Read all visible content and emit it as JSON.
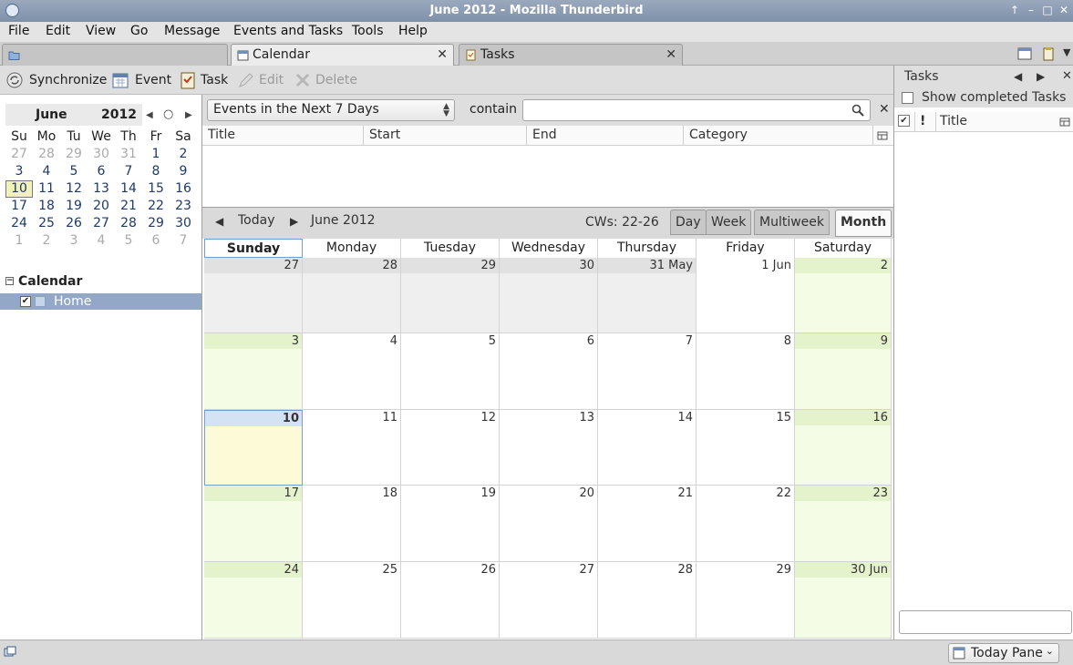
{
  "window": {
    "title": "June 2012 - Mozilla Thunderbird",
    "buttons": [
      "↑",
      "–",
      "□",
      "✕"
    ]
  },
  "menu": [
    "File",
    "Edit",
    "View",
    "Go",
    "Message",
    "Events and Tasks",
    "Tools",
    "Help"
  ],
  "tabs": [
    {
      "label": "",
      "icon": "folder-icon"
    },
    {
      "label": "Calendar",
      "icon": "calendar-icon",
      "active": true
    },
    {
      "label": "Tasks",
      "icon": "tasks-icon"
    }
  ],
  "tab_close": "✕",
  "toolbar": {
    "synchronize": "Synchronize",
    "event": "Event",
    "task": "Task",
    "edit": "Edit",
    "delete": "Delete"
  },
  "minimonth": {
    "month": "June",
    "year": "2012",
    "nav": [
      "◀",
      "○",
      "▶"
    ],
    "weekdays": [
      "Su",
      "Mo",
      "Tu",
      "We",
      "Th",
      "Fr",
      "Sa"
    ],
    "weeks": [
      [
        "27",
        "28",
        "29",
        "30",
        "31",
        "1",
        "2"
      ],
      [
        "3",
        "4",
        "5",
        "6",
        "7",
        "8",
        "9"
      ],
      [
        "10",
        "11",
        "12",
        "13",
        "14",
        "15",
        "16"
      ],
      [
        "17",
        "18",
        "19",
        "20",
        "21",
        "22",
        "23"
      ],
      [
        "24",
        "25",
        "26",
        "27",
        "28",
        "29",
        "30"
      ],
      [
        "1",
        "2",
        "3",
        "4",
        "5",
        "6",
        "7"
      ]
    ],
    "today": "10"
  },
  "calendar_list": {
    "header": "Calendar",
    "collapse": "−",
    "items": [
      {
        "name": "Home",
        "checked": "✔"
      }
    ]
  },
  "filter": {
    "selected": "Events in the Next 7 Days",
    "contain_label": "contain",
    "close": "✕"
  },
  "event_columns": [
    "Title",
    "Start",
    "End",
    "Category"
  ],
  "nav": {
    "prev": "◀",
    "today": "Today",
    "next": "▶",
    "period": "June 2012",
    "cws": "CWs: 22-26",
    "views": [
      "Day",
      "Week",
      "Multiweek",
      "Month"
    ],
    "active_view": "Month"
  },
  "month_view": {
    "day_headers": [
      "Sunday",
      "Monday",
      "Tuesday",
      "Wednesday",
      "Thursday",
      "Friday",
      "Saturday"
    ],
    "weeks": [
      [
        "27",
        "28",
        "29",
        "30",
        "31 May",
        "1 Jun",
        "2"
      ],
      [
        "3",
        "4",
        "5",
        "6",
        "7",
        "8",
        "9"
      ],
      [
        "10",
        "11",
        "12",
        "13",
        "14",
        "15",
        "16"
      ],
      [
        "17",
        "18",
        "19",
        "20",
        "21",
        "22",
        "23"
      ],
      [
        "24",
        "25",
        "26",
        "27",
        "28",
        "29",
        "30 Jun"
      ]
    ]
  },
  "tasks_pane": {
    "title": "Tasks",
    "nav": [
      "◀",
      "▶"
    ],
    "close": "✕",
    "show_completed": "Show completed Tasks",
    "col_check": "✔",
    "col_priority": "!",
    "col_title": "Title"
  },
  "statusbar": {
    "today_pane": "Today Pane",
    "arrow": "⌄"
  },
  "colors": {
    "titlebar": "#8a9cb4",
    "selection": "#92a8c6",
    "weekend": "#f4fce5",
    "today": "#fdfbd7"
  }
}
